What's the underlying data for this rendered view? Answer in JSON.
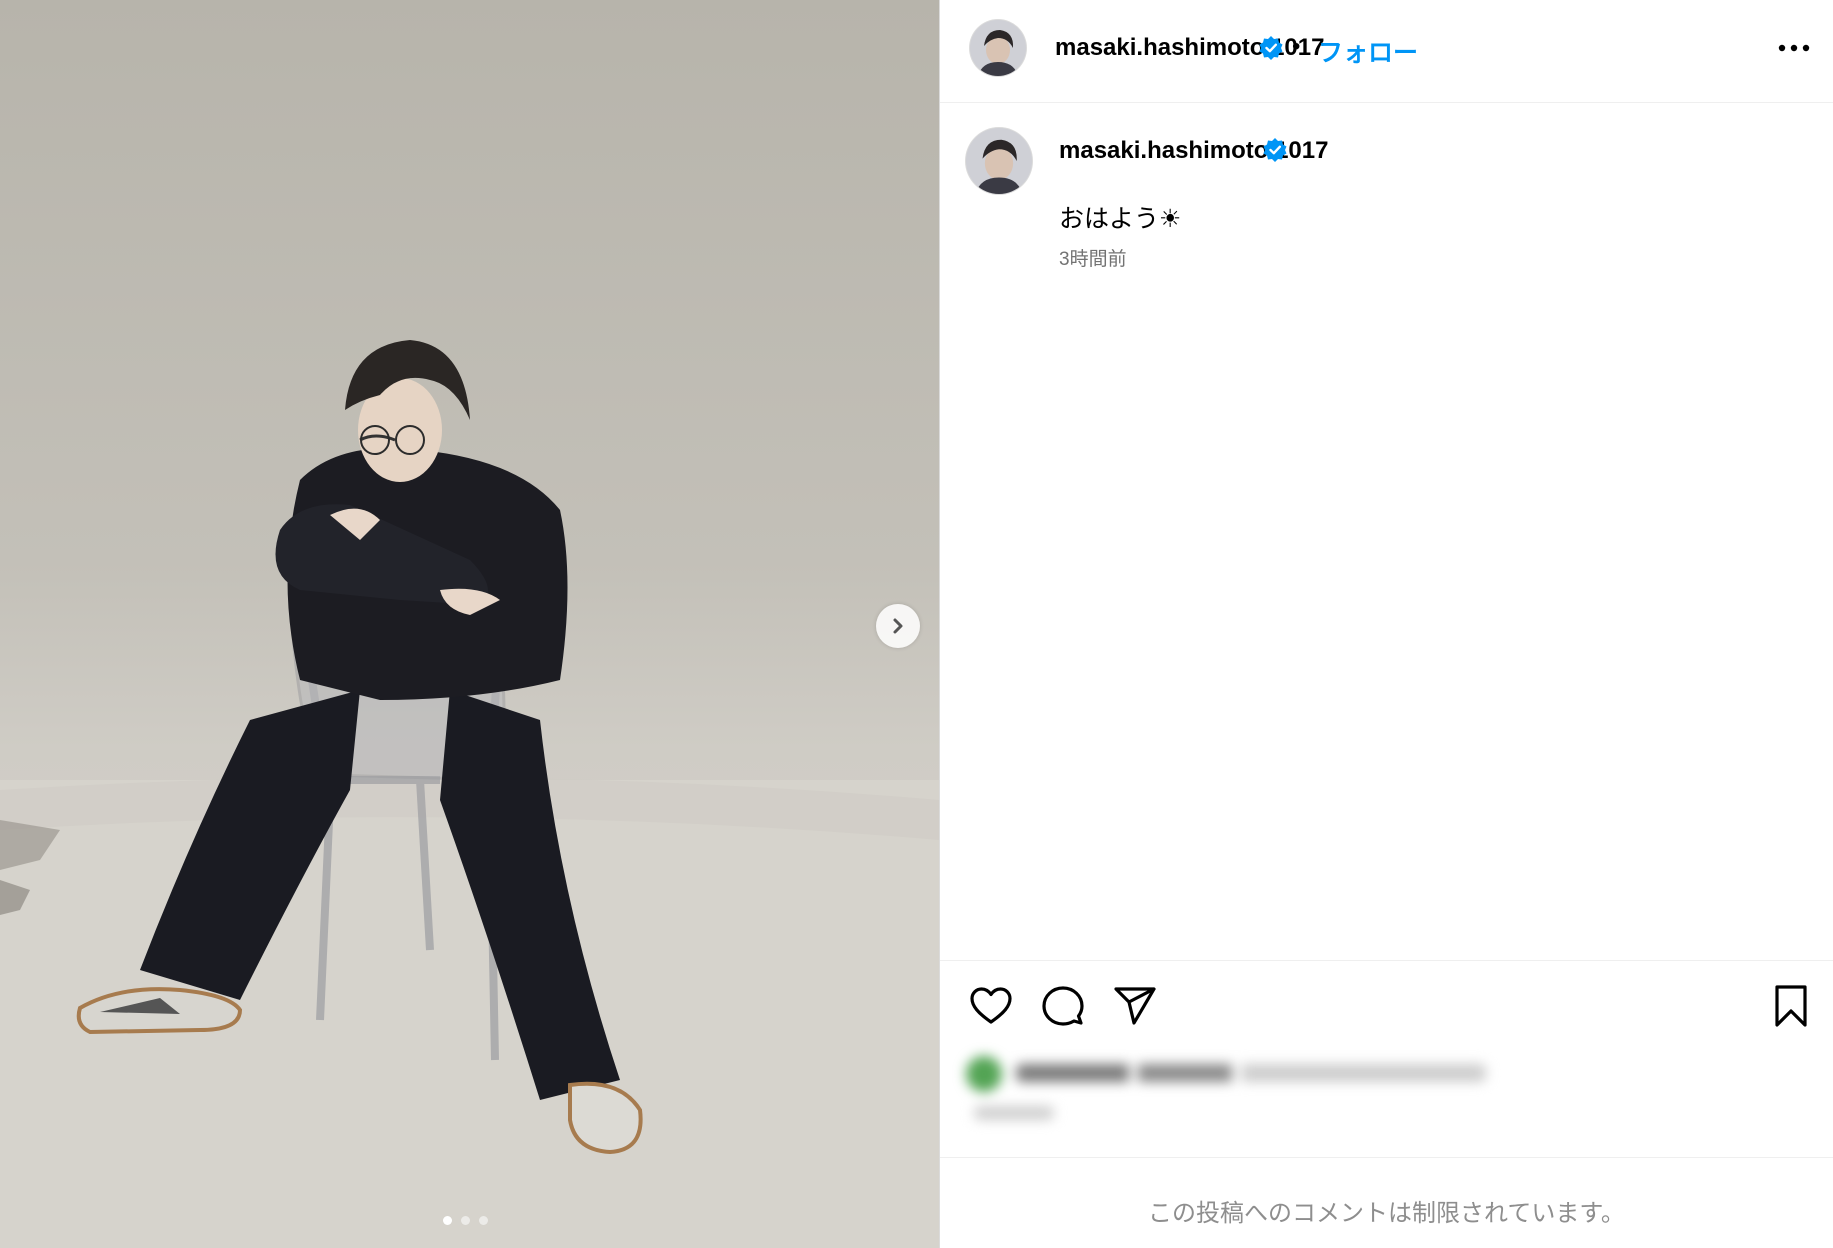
{
  "header": {
    "username": "masaki.hashimoto.1017",
    "separator": "•",
    "follow_label": "フォロー"
  },
  "caption": {
    "username": "masaki.hashimoto.1017",
    "text": "おはよう☀",
    "timestamp": "3時間前"
  },
  "carousel": {
    "slide_count": 3,
    "active_index": 0
  },
  "comments": {
    "disabled_notice": "この投稿へのコメントは制限されています。"
  },
  "icons": {
    "verified": "verified-badge-icon",
    "more": "more-options-icon",
    "next": "chevron-right-icon",
    "like": "heart-icon",
    "comment": "comment-bubble-icon",
    "share": "paper-plane-icon",
    "save": "bookmark-icon"
  },
  "colors": {
    "accent": "#0095f6",
    "secondary_text": "#737373",
    "muted_text": "#8e8e8e",
    "border": "#dbdbdb"
  }
}
